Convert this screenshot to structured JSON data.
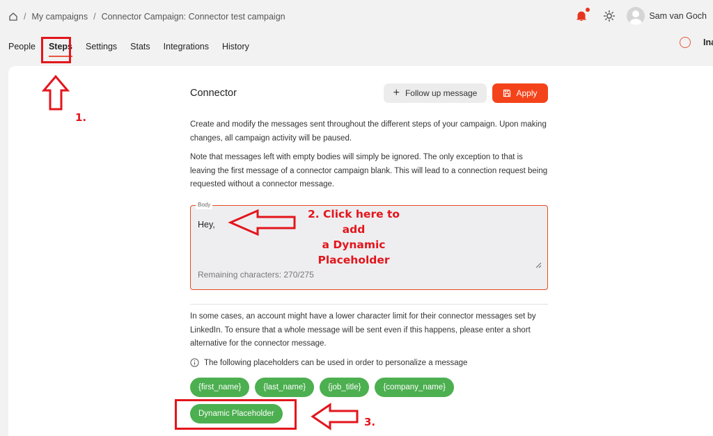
{
  "breadcrumb": {
    "items": [
      "My campaigns",
      "Connector Campaign: Connector test campaign"
    ]
  },
  "user": {
    "name": "Sam van Goch"
  },
  "tabs": [
    {
      "label": "People"
    },
    {
      "label": "Steps"
    },
    {
      "label": "Settings"
    },
    {
      "label": "Stats"
    },
    {
      "label": "Integrations"
    },
    {
      "label": "History"
    }
  ],
  "status": {
    "label": "Ina"
  },
  "main": {
    "title": "Connector",
    "follow_up_label": "Follow up message",
    "apply_label": "Apply",
    "intro": "Create and modify the messages sent throughout the different steps of your campaign. Upon making changes, all campaign activity will be paused.",
    "note": "Note that messages left with empty bodies will simply be ignored. The only exception to that is leaving the first message of a connector campaign blank. This will lead to a connection request being requested without a connector message.",
    "body": {
      "label": "Body",
      "value": "Hey,",
      "remaining": "Remaining characters: 270/275"
    },
    "limit_note": "In some cases, an account might have a lower character limit for their connector messages set by LinkedIn. To ensure that a whole message will be sent even if this happens, please enter a short alternative for the connector message.",
    "placeholders_note": "The following placeholders can be used in order to personalize a message",
    "placeholders": [
      "{first_name}",
      "{last_name}",
      "{job_title}",
      "{company_name}"
    ],
    "dynamic_placeholder_label": "Dynamic Placeholder"
  },
  "annotations": {
    "step1": "1.",
    "step2_line1": "2. Click here to add",
    "step2_line2": "a Dynamic",
    "step2_line3": "Placeholder",
    "step3": "3."
  },
  "colors": {
    "accent": "#f4431a",
    "chip_green": "#4caf50",
    "annotation_red": "#e3151c"
  },
  "icons": [
    "home-icon",
    "bell-icon",
    "sun-icon",
    "avatar",
    "plus-icon",
    "save-icon",
    "info-icon",
    "resize-handle-icon"
  ]
}
